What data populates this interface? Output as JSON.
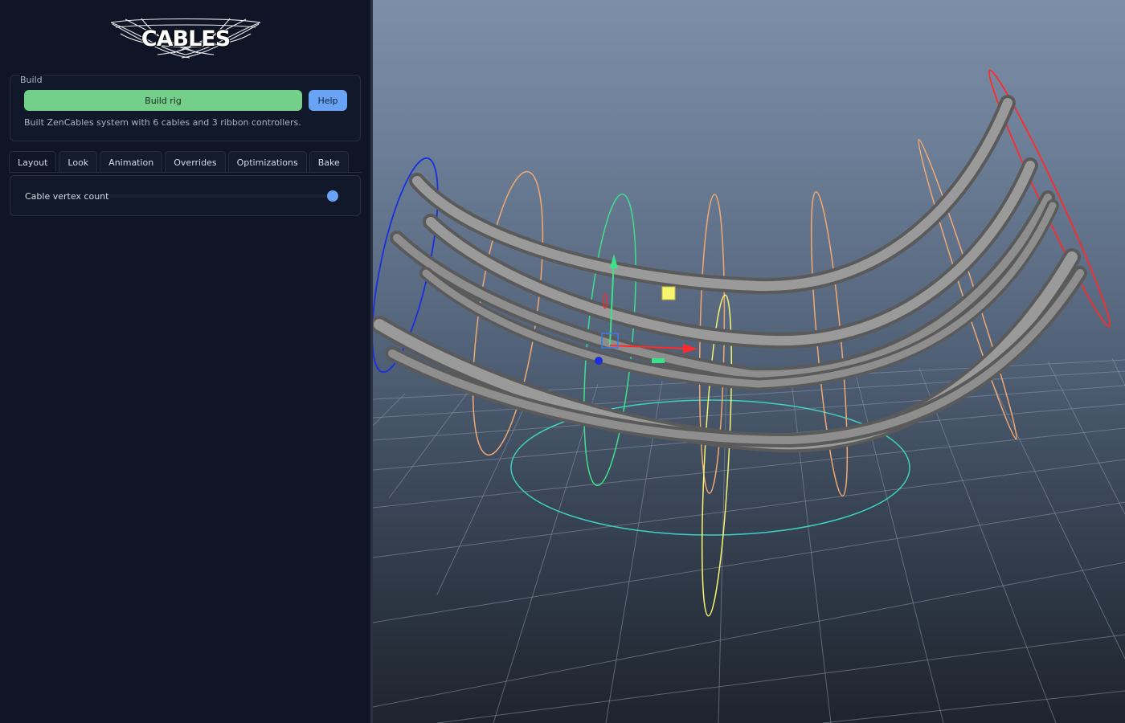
{
  "panel": {
    "logo_text": "CABLES",
    "build_group": {
      "title": "Build",
      "build_button_label": "Build rig",
      "help_button_label": "Help",
      "status_text": "Built ZenCables system with 6 cables and 3 ribbon controllers."
    },
    "tabs": [
      {
        "label": "Layout"
      },
      {
        "label": "Look"
      },
      {
        "label": "Animation"
      },
      {
        "label": "Overrides"
      },
      {
        "label": "Optimizations"
      },
      {
        "label": "Bake"
      }
    ],
    "active_tab": "Layout",
    "layout": {
      "vertex_count_label": "Cable vertex count",
      "vertex_count_level": 1.0
    }
  },
  "colors": {
    "accent_green": "#73cf8a",
    "accent_blue": "#69a3f5",
    "panel_bg": "#0f1526"
  },
  "viewport": {
    "controllers": [
      {
        "color": "#1a2ee0"
      },
      {
        "color": "#f2a86e"
      },
      {
        "color": "#3fe08a"
      },
      {
        "color": "#f2a86e"
      },
      {
        "color": "#f2a86e"
      },
      {
        "color": "#f2a86e"
      },
      {
        "color": "#ff2a2a"
      },
      {
        "color": "#f5f56e"
      },
      {
        "color": "#3fd0c0"
      }
    ],
    "cable_color": "#8a8a8a"
  }
}
